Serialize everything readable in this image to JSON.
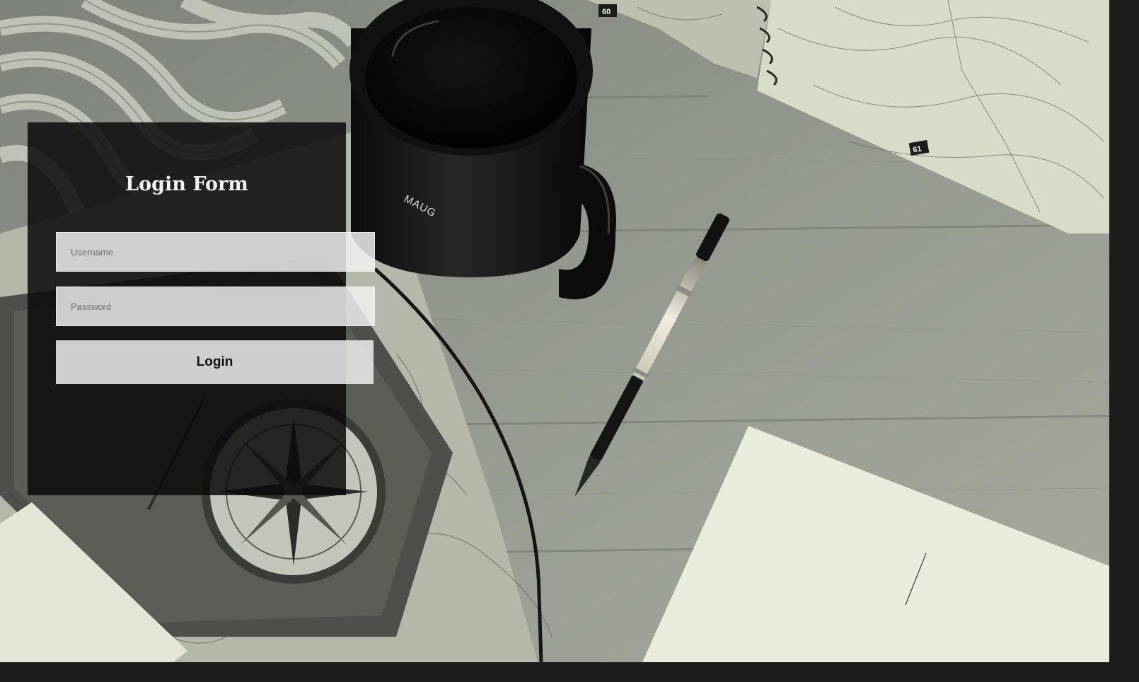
{
  "form": {
    "title": "Login Form",
    "username": {
      "placeholder": "Username",
      "value": ""
    },
    "password": {
      "placeholder": "Password",
      "value": ""
    },
    "login_label": "Login"
  },
  "background": {
    "mug_text": "MAUG",
    "map_markers": [
      "60",
      "61"
    ]
  },
  "colors": {
    "panel": "#0a0a0a",
    "field": "#f0f2f0",
    "title": "#f1f1ee",
    "wood": "#8b9088"
  }
}
